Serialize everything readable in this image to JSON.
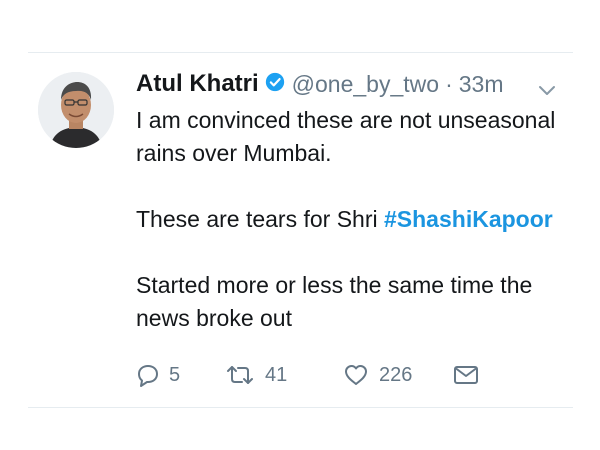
{
  "tweet": {
    "author_name": "Atul Khatri",
    "handle": "@one_by_two",
    "separator": "·",
    "timestamp": "33m",
    "paragraphs": [
      {
        "text": "I am convinced these are not unseasonal rains over Mumbai."
      },
      {
        "text": "These are tears for Shri ",
        "hashtag": "#ShashiKapoor"
      },
      {
        "text": "Started more or less the same time the news broke out"
      }
    ],
    "actions": {
      "replies": "5",
      "retweets": "41",
      "likes": "226"
    },
    "icons": {
      "verified": "verified-badge-icon",
      "caret": "chevron-down-icon",
      "reply": "reply-icon",
      "retweet": "retweet-icon",
      "like": "heart-icon",
      "dm": "envelope-icon"
    }
  },
  "colors": {
    "text": "#14171a",
    "muted": "#657786",
    "link": "#1b95e0",
    "verified": "#1da1f2"
  }
}
